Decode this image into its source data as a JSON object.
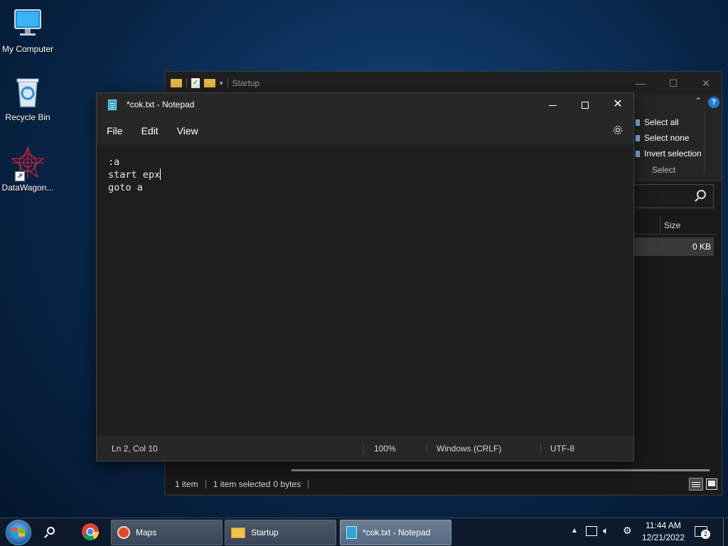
{
  "desktop": {
    "icons": [
      {
        "label": "My Computer",
        "icon": "monitor-icon"
      },
      {
        "label": "Recycle Bin",
        "icon": "recycle-bin-icon"
      },
      {
        "label": "DataWagon...",
        "icon": "datawagon-icon"
      }
    ]
  },
  "explorer": {
    "title": "Startup",
    "ribbon": {
      "select_all": "Select all",
      "select_none": "Select none",
      "invert_selection": "Invert selection",
      "group_label": "Select"
    },
    "column_header": "Size",
    "file_size": "0 KB",
    "status": {
      "items": "1 item",
      "selected": "1 item selected",
      "bytes": "0 bytes"
    }
  },
  "notepad": {
    "title": "*cok.txt - Notepad",
    "menu": [
      "File",
      "Edit",
      "View"
    ],
    "content_lines": [
      ":a",
      "start epx",
      "goto a"
    ],
    "status": {
      "position": "Ln 2, Col 10",
      "zoom": "100%",
      "line_ending": "Windows (CRLF)",
      "encoding": "UTF-8"
    }
  },
  "taskbar": {
    "buttons": [
      {
        "label": "Maps",
        "icon": "maps-icon"
      },
      {
        "label": "Startup",
        "icon": "folder-icon"
      },
      {
        "label": "*cok.txt - Notepad",
        "icon": "notepad-icon"
      }
    ],
    "clock": {
      "time": "11:44 AM",
      "date": "12/21/2022"
    },
    "notification_count": "2"
  },
  "colors": {
    "accent": "#0078d7",
    "help": "#1e7ad6"
  }
}
